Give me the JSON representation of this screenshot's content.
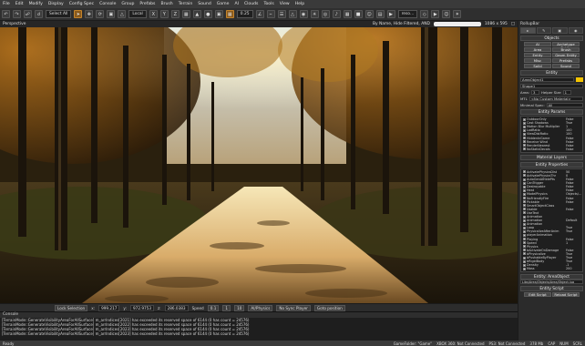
{
  "menu": [
    "File",
    "Edit",
    "Modify",
    "Display",
    "Config Spec",
    "Console",
    "Group",
    "Prefabs",
    "Brush",
    "Terrain",
    "Sound",
    "Game",
    "AI",
    "Clouds",
    "Tools",
    "View",
    "Help"
  ],
  "toolbar": {
    "select_all": "Select All",
    "coord_system": "Local",
    "snap_value": "0.25",
    "zoom": "1",
    "render_label": "reso…"
  },
  "viewport": {
    "label": "Perspective",
    "info": "By Name, Hide Filtered, AND",
    "resolution": "1086 x 595"
  },
  "viewport_status": {
    "lock_selection": "Lock Selection",
    "x_label": "x:",
    "x": "999.217",
    "y_label": "y:",
    "y": "972.9753",
    "z_label": "z:",
    "z": "286.0383",
    "speed_label": "Speed",
    "speed_values": [
      "0.1",
      "1",
      "10"
    ],
    "ai_physics": "AI/Physics",
    "no_sync": "No Sync Player",
    "goto_position": "Goto position"
  },
  "console": {
    "title": "Console",
    "lines": [
      "[TerrainMode::GenerateVisibilityAreaForAllSurface] m_arrIndices[2021] has exceeded its reserved space of 6144 (0 has count = 24576)",
      "[TerrainMode::GenerateVisibilityAreaForAllSurface] m_arrIndices[2022] has exceeded its reserved space of 6144 (0 has count = 24576)",
      "[TerrainMode::GenerateVisibilityAreaForAllSurface] m_arrIndices[2023] has exceeded its reserved space of 6144 (0 has count = 24576)",
      "[TerrainMode::GenerateVisibilityAreaForAllSurface] m_arrIndices[2023] has exceeded its reserved space of 6144 (0 has count = 24576)"
    ]
  },
  "statusbar": {
    "left": "Ready",
    "gamefolder": "GameFolder: \"Game\"",
    "xbox": "XBOX 360: Not Connected",
    "ps3": "PS3: Not Connected",
    "memory": "378 Mb",
    "cap": "CAP",
    "num": "NUM",
    "scrl": "SCRL"
  },
  "rollup": {
    "title": "RollupBar",
    "tabs": [
      "▸",
      "✎",
      "▣",
      "◉"
    ],
    "objects_title": "Objects",
    "objects": [
      "AI",
      "Archetype Entity",
      "Area",
      "Brush",
      "Entity",
      "Geom Entity",
      "Misc",
      "Prefabs",
      "Solid",
      "Sound"
    ],
    "entity_title": "Entity",
    "entity_name": "AreaObject1",
    "entity_color": "#f5c400",
    "entity_class": "Shape1",
    "area_label": "Area:",
    "area_value": "3",
    "height_label": "Helper Size",
    "height_value": "1",
    "mtl_label": "MTL",
    "mtl_value": "<No Custom Material>",
    "min_spec_label": "Minimal Spec:",
    "min_spec_value": "All",
    "params_title": "Entity Params",
    "params": [
      {
        "name": "OutdoorOnly",
        "value": "False"
      },
      {
        "name": "Cast Shadows",
        "value": "True"
      },
      {
        "name": "Motion Blur Multiplier",
        "value": "1"
      },
      {
        "name": "LodRatio",
        "value": "100"
      },
      {
        "name": "ViewDistRatio",
        "value": "100"
      },
      {
        "name": "HiddenInGame",
        "value": "False"
      },
      {
        "name": "Receive Wind",
        "value": "False"
      },
      {
        "name": "RenderNearest",
        "value": "False"
      },
      {
        "name": "NoStaticDecals",
        "value": "False"
      }
    ],
    "material_title": "Material Layers",
    "props_title": "Entity Properties",
    "props": [
      {
        "name": "ActivatePhysicsDist",
        "value": "50"
      },
      {
        "name": "ActivatePhysicsThr",
        "value": "0"
      },
      {
        "name": "AutoGenAIHidePts",
        "value": "False"
      },
      {
        "name": "CanTrigger",
        "value": "False"
      },
      {
        "name": "Destroyable",
        "value": "False"
      },
      {
        "name": "Heat",
        "value": "False"
      },
      {
        "name": "ModelPhysics",
        "value": "Objects/..."
      },
      {
        "name": "NoFriendlyFire",
        "value": "False"
      },
      {
        "name": "Pickable",
        "value": "False"
      },
      {
        "name": "SmartObjectClass",
        "value": ""
      },
      {
        "name": "Usable",
        "value": "False"
      },
      {
        "name": "UseText",
        "value": ""
      },
      {
        "name": "Animation",
        "value": ""
      },
      {
        "name": "Animation",
        "value": "Default"
      },
      {
        "name": "Animation",
        "value": ""
      },
      {
        "name": "Loop",
        "value": "True"
      },
      {
        "name": "PhysicalizeAfterAnim",
        "value": "True"
      },
      {
        "name": "playerAnimation",
        "value": ""
      },
      {
        "name": "Playing",
        "value": "False"
      },
      {
        "name": "Speed",
        "value": "1"
      },
      {
        "name": "Physics",
        "value": ""
      },
      {
        "name": "bActivateOnDamage",
        "value": "False"
      },
      {
        "name": "bPhysicalize",
        "value": "True"
      },
      {
        "name": "bPushableByPlayer",
        "value": "True"
      },
      {
        "name": "bRigidBody",
        "value": "True"
      },
      {
        "name": "Density",
        "value": "-1"
      },
      {
        "name": "Mass",
        "value": "200"
      }
    ],
    "entity_links_title": "Entity: AreaObject",
    "entity_links_path": "Libs/Area/Objects/Area/Object.lua",
    "script_title": "Entity Script",
    "edit_script": "Edit Script",
    "reload_script": "Reload Script"
  }
}
